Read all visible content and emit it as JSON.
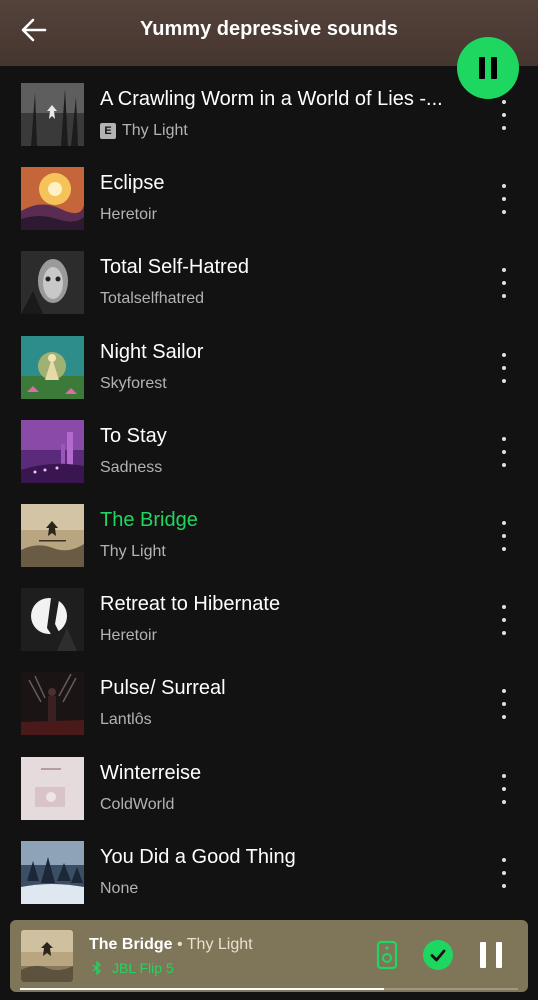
{
  "header": {
    "title": "Yummy depressive sounds",
    "back_icon": "arrow-left-icon",
    "play_state": "pause-icon"
  },
  "explicit_badge": "E",
  "tracks": [
    {
      "title": "A Crawling Worm in a World of Lies -...",
      "artist": "Thy Light",
      "explicit": true,
      "active": false,
      "cover": "dark-forest"
    },
    {
      "title": "Eclipse",
      "artist": "Heretoir",
      "explicit": false,
      "active": false,
      "cover": "fiery-sky"
    },
    {
      "title": "Total Self-Hatred",
      "artist": "Totalselfhatred",
      "explicit": false,
      "active": false,
      "cover": "grey-face"
    },
    {
      "title": "Night Sailor",
      "artist": "Skyforest",
      "explicit": false,
      "active": false,
      "cover": "green-lotus"
    },
    {
      "title": "To Stay",
      "artist": "Sadness",
      "explicit": false,
      "active": false,
      "cover": "purple-city"
    },
    {
      "title": "The Bridge",
      "artist": "Thy Light",
      "explicit": false,
      "active": true,
      "cover": "sepia-emblem"
    },
    {
      "title": "Retreat to Hibernate",
      "artist": "Heretoir",
      "explicit": false,
      "active": false,
      "cover": "white-moon"
    },
    {
      "title": "Pulse/ Surreal",
      "artist": "Lantlôs",
      "explicit": false,
      "active": false,
      "cover": "dark-red-figure"
    },
    {
      "title": "Winterreise",
      "artist": "ColdWorld",
      "explicit": false,
      "active": false,
      "cover": "pale-pink"
    },
    {
      "title": "You Did a Good Thing",
      "artist": "None",
      "explicit": false,
      "active": false,
      "cover": "snowy-forest"
    }
  ],
  "now_playing": {
    "title": "The Bridge",
    "separator": " • ",
    "artist": "Thy Light",
    "device": "JBL Flip 5",
    "progress": 0.73
  },
  "colors": {
    "accent": "#1ed760",
    "header_bg": "#4e3d36",
    "list_bg": "#121212",
    "mini_player_bg": "#7f7558"
  }
}
